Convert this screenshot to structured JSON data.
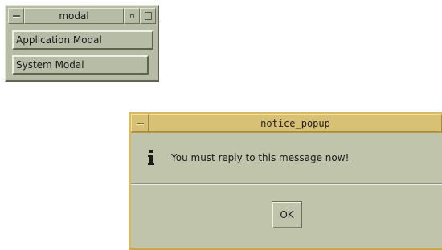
{
  "modal_window": {
    "title": "modal",
    "buttons": {
      "application_modal": "Application Modal",
      "system_modal": "System Modal"
    }
  },
  "notice_popup": {
    "title": "notice_popup",
    "message": "You must reply to this message now!",
    "ok_label": "OK",
    "icon": "info-icon"
  },
  "colors": {
    "window_bg": "#b6bca6",
    "popup_bg": "#c0c4ab",
    "popup_title_bg": "#d8c074",
    "popup_border": "#d9b967"
  }
}
